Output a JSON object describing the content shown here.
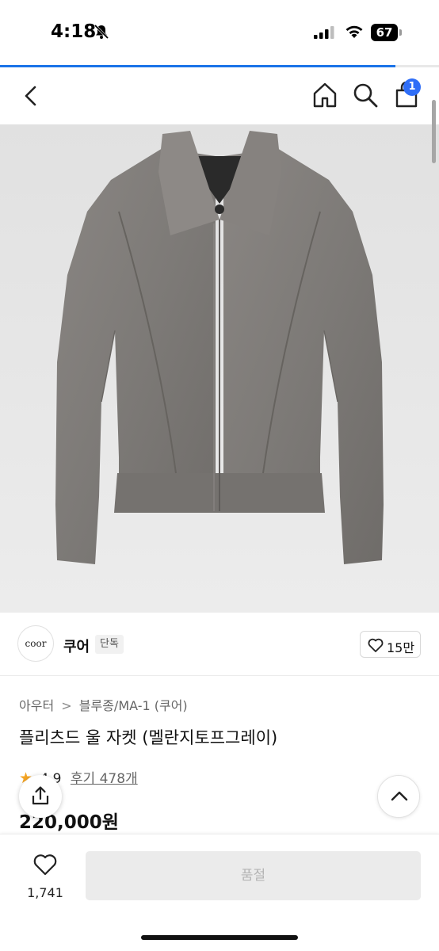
{
  "status_bar": {
    "time": "4:18",
    "battery": "67"
  },
  "page_load_progress": 0.9,
  "header": {
    "cart_badge": "1"
  },
  "product": {
    "image_alt": "",
    "brand_logo_text": "coor",
    "brand_name": "쿠어",
    "exclusive_badge": "단독",
    "like_count": "15만",
    "breadcrumb": [
      "아우터",
      "블루종/MA-1 (쿠어)"
    ],
    "breadcrumb_separator": ">",
    "title": "플리츠드 울 자켓 (멜란지토프그레이)",
    "rating": "4.9",
    "review_label": "후기 478개",
    "price": "220,000원"
  },
  "bottom_bar": {
    "wishlist_count": "1,741",
    "buy_button_label": "품절"
  },
  "colors": {
    "accent": "#2f6ef7",
    "load_bar": "#1a73e8",
    "star": "#f5a524",
    "soldout_bg": "#ebebeb"
  },
  "icons": [
    "bell-slash-icon",
    "signal-icon",
    "wifi-icon",
    "battery-icon",
    "back-chevron-icon",
    "home-icon",
    "search-icon",
    "cart-icon",
    "heart-icon",
    "star-icon",
    "share-icon",
    "chevron-up-icon"
  ]
}
